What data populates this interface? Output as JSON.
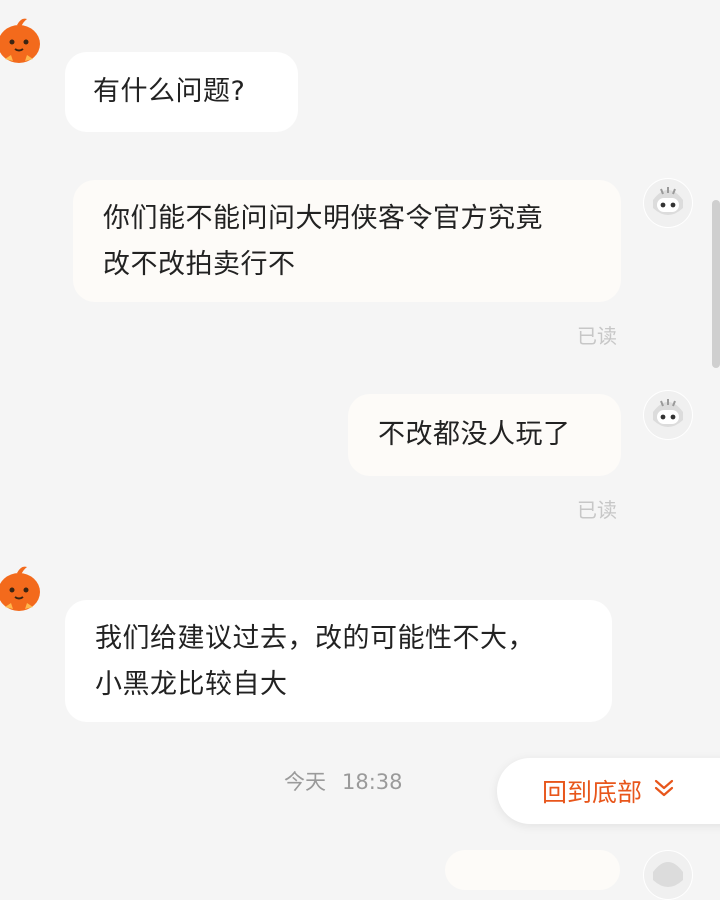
{
  "messages": [
    {
      "sender": "support",
      "text": "有什么问题?"
    },
    {
      "sender": "user",
      "line1": "你们能不能问问大明侠客令官方究竟",
      "line2": "改不改拍卖行不",
      "status": "已读"
    },
    {
      "sender": "user",
      "text": "不改都没人玩了",
      "status": "已读"
    },
    {
      "sender": "support",
      "line1": "我们给建议过去，改的可能性不大，",
      "line2": "小黑龙比较自大"
    }
  ],
  "timestamp": {
    "day": "今天",
    "time": "18:38"
  },
  "scroll_to_bottom": {
    "label": "回到底部",
    "icon": "double-chevron-down-icon"
  },
  "colors": {
    "accent": "#e8561b",
    "background": "#f5f5f5",
    "incoming_bubble": "#ffffff",
    "outgoing_bubble": "#fdfbf8",
    "read_text": "#c7c7c7"
  }
}
